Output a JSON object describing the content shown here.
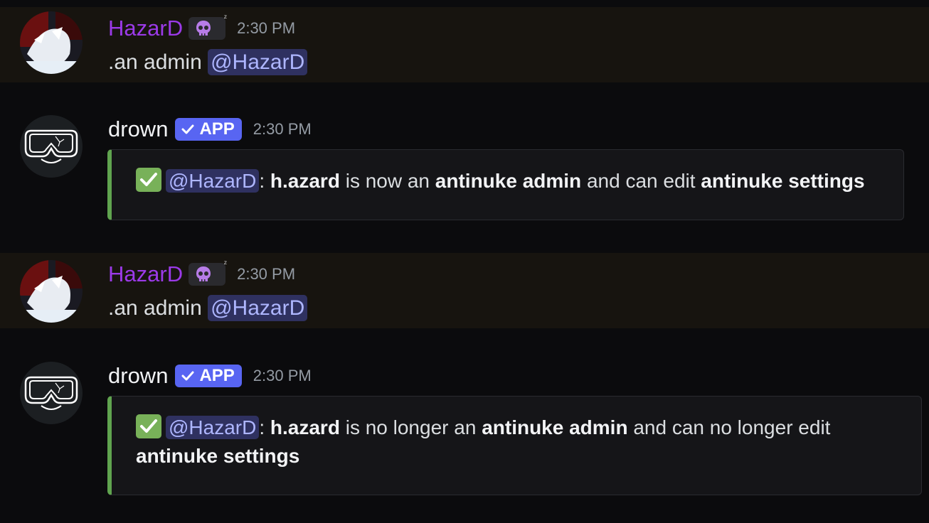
{
  "messages": [
    {
      "author": "HazarD",
      "badge_icon": "skull-emoji-icon",
      "badge_sup": "ᶻ",
      "timestamp": "2:30 PM",
      "text": ".an admin",
      "mention": "@HazarD",
      "color": "#9b3ae8"
    },
    {
      "author": "drown",
      "app_badge": "APP",
      "timestamp": "2:30 PM",
      "embed": {
        "accent": "#60a44f",
        "mention": "@HazarD",
        "sep": ":",
        "user": "h.azard",
        "t1": " is now an ",
        "b1": "antinuke admin",
        "t2": " and can edit ",
        "b2": "antinuke settings"
      }
    },
    {
      "author": "HazarD",
      "badge_icon": "skull-emoji-icon",
      "badge_sup": "ᶻ",
      "timestamp": "2:30 PM",
      "text": ".an admin",
      "mention": "@HazarD",
      "color": "#9b3ae8"
    },
    {
      "author": "drown",
      "app_badge": "APP",
      "timestamp": "2:30 PM",
      "embed": {
        "accent": "#60a44f",
        "mention": "@HazarD",
        "sep": ":",
        "user": "h.azard",
        "t1": " is no longer an ",
        "b1": "antinuke admin",
        "t2": " and can no longer edit",
        "b2": "antinuke settings"
      }
    }
  ]
}
